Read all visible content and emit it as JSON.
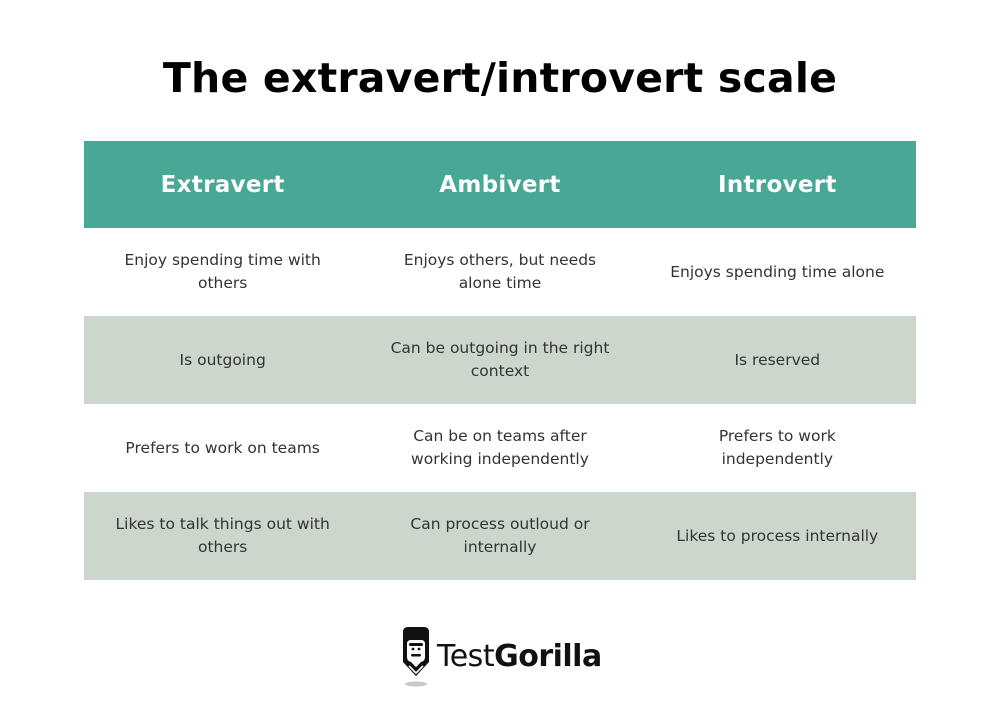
{
  "title": "The extravert/introvert scale",
  "colors": {
    "header_bg": "#48a895",
    "shaded_row_bg": "#ccd6cc",
    "header_text": "#ffffff",
    "body_text": "#333333"
  },
  "table": {
    "headers": [
      "Extravert",
      "Ambivert",
      "Introvert"
    ],
    "rows": [
      [
        "Enjoy spending time with others",
        "Enjoys others, but needs alone time",
        "Enjoys spending time alone"
      ],
      [
        "Is outgoing",
        "Can be outgoing in the right context",
        "Is reserved"
      ],
      [
        "Prefers to work on teams",
        "Can be on teams after working independently",
        "Prefers to work independently"
      ],
      [
        "Likes to talk things out with others",
        "Can process outloud or internally",
        "Likes to process internally"
      ]
    ]
  },
  "logo": {
    "icon": "gorilla-pencil-icon",
    "text_light": "Test",
    "text_bold": "Gorilla"
  }
}
